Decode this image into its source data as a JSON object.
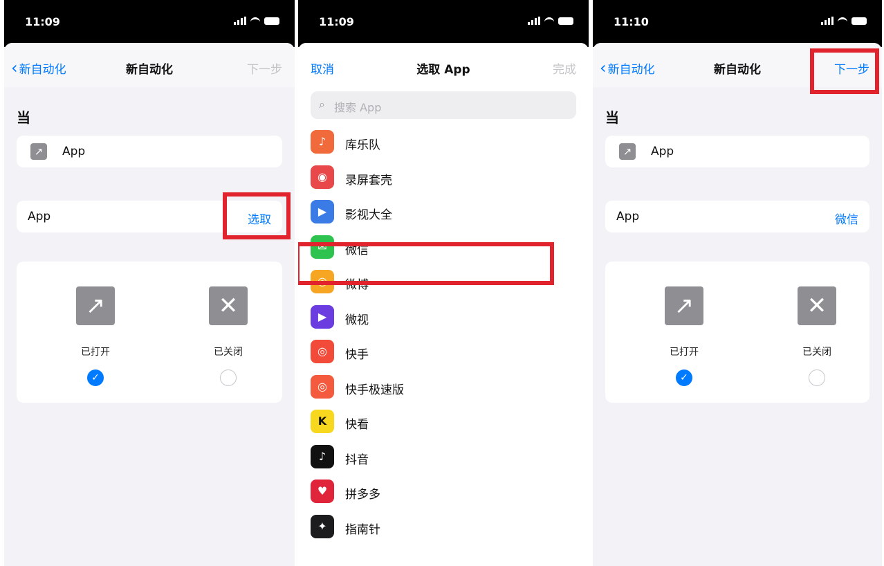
{
  "statusbar": {
    "time1": "11:09",
    "time2": "11:09",
    "time3": "11:10"
  },
  "screen1": {
    "nav": {
      "back": "新自动化",
      "title": "新自动化",
      "next": "下一步"
    },
    "section": "当",
    "trigger_label": "App",
    "app_row": {
      "label": "App",
      "value": "选取"
    },
    "options": {
      "opened": "已打开",
      "closed": "已关闭"
    }
  },
  "screen2": {
    "nav": {
      "cancel": "取消",
      "title": "选取 App",
      "done": "完成"
    },
    "search_placeholder": "搜索 App",
    "apps": [
      {
        "name": "库乐队",
        "color": "#f06a3b",
        "glyph": "♪"
      },
      {
        "name": "录屏套壳",
        "color": "#e8484a",
        "glyph": "◉"
      },
      {
        "name": "影视大全",
        "color": "#3a7be6",
        "glyph": "▶"
      },
      {
        "name": "微信",
        "color": "#2dc34e",
        "glyph": "✉"
      },
      {
        "name": "微博",
        "color": "#f7a623",
        "glyph": "◎"
      },
      {
        "name": "微视",
        "color": "#6b3ce0",
        "glyph": "▶"
      },
      {
        "name": "快手",
        "color": "#f24b3a",
        "glyph": "◎"
      },
      {
        "name": "快手极速版",
        "color": "#f45a3d",
        "glyph": "◎"
      },
      {
        "name": "快看",
        "color": "#f8d81e",
        "glyph": "K"
      },
      {
        "name": "抖音",
        "color": "#111111",
        "glyph": "♪"
      },
      {
        "name": "拼多多",
        "color": "#e0243a",
        "glyph": "♥"
      },
      {
        "name": "指南针",
        "color": "#1c1c1e",
        "glyph": "✦"
      }
    ]
  },
  "screen3": {
    "nav": {
      "back": "新自动化",
      "title": "新自动化",
      "next": "下一步"
    },
    "section": "当",
    "trigger_label": "App",
    "app_row": {
      "label": "App",
      "value": "微信"
    },
    "options": {
      "opened": "已打开",
      "closed": "已关闭"
    }
  },
  "colors": {
    "accent": "#007aff",
    "highlight": "#e0232d"
  }
}
